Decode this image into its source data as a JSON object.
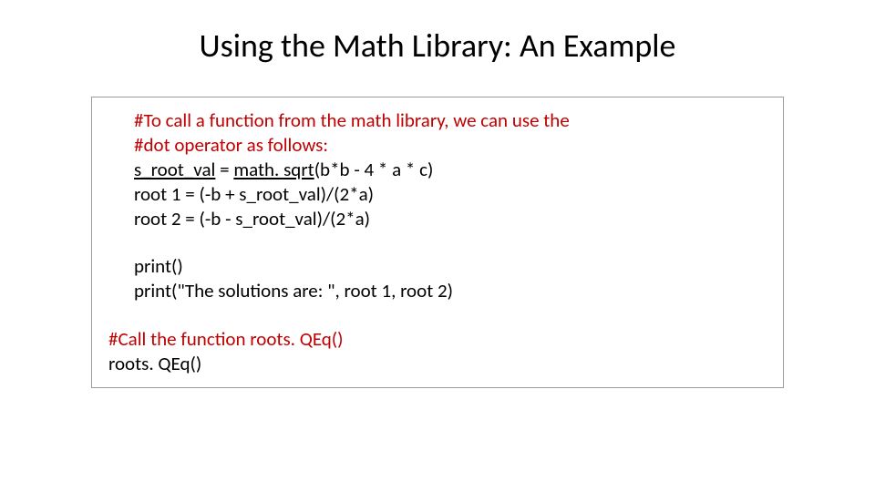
{
  "title": "Using the Math Library: An Example",
  "code": {
    "comment1_line1": "#To call a function from the math library, we can use the",
    "comment1_line2": "#dot operator as follows:",
    "line1_prefix": "s_root_val",
    "line1_eq": " = ",
    "line1_underlined": "math. sqrt",
    "line1_suffix": "(b*b - 4 * a * c)",
    "line2": "root 1 = (-b + s_root_val)/(2*a)",
    "line3": "root 2 = (-b - s_root_val)/(2*a)",
    "line4": "print()",
    "line5": "print(\"The solutions are: \", root 1, root 2)",
    "comment2": "#Call the function roots. QEq()",
    "line6": "roots. QEq()"
  }
}
